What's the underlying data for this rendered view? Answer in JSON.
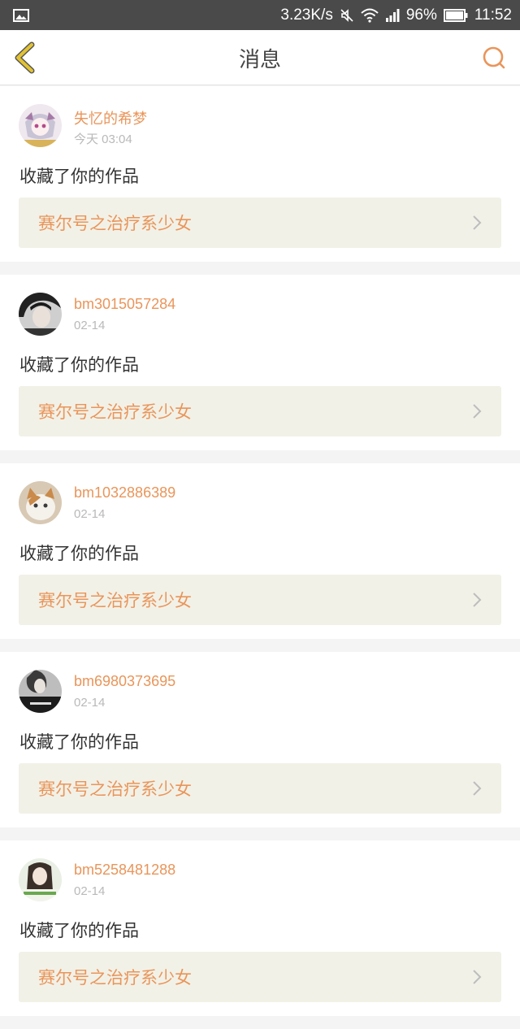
{
  "status_bar": {
    "speed": "3.23K/s",
    "battery": "96%",
    "time": "11:52"
  },
  "header": {
    "title": "消息"
  },
  "messages": [
    {
      "username": "失忆的希梦",
      "time": "今天 03:04",
      "action": "收藏了你的作品",
      "work_title": "赛尔号之治疗系少女"
    },
    {
      "username": "bm3015057284",
      "time": "02-14",
      "action": "收藏了你的作品",
      "work_title": "赛尔号之治疗系少女"
    },
    {
      "username": "bm1032886389",
      "time": "02-14",
      "action": "收藏了你的作品",
      "work_title": "赛尔号之治疗系少女"
    },
    {
      "username": "bm6980373695",
      "time": "02-14",
      "action": "收藏了你的作品",
      "work_title": "赛尔号之治疗系少女"
    },
    {
      "username": "bm5258481288",
      "time": "02-14",
      "action": "收藏了你的作品",
      "work_title": "赛尔号之治疗系少女"
    }
  ],
  "colors": {
    "accent": "#e9955a",
    "back_arrow": "#e2c233",
    "link_background": "#f2f1e7"
  }
}
